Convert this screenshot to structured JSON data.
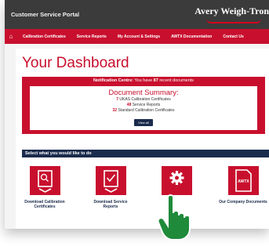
{
  "header": {
    "portal_title": "Customer Service Portal",
    "brand": "Avery Weigh-Tron"
  },
  "nav": {
    "home_icon": "home-icon",
    "items": [
      {
        "label": "Calibration Certificates"
      },
      {
        "label": "Service Reports"
      },
      {
        "label": "My Account & Settings"
      },
      {
        "label": "AWTX Documentation"
      },
      {
        "label": "Contact Us"
      }
    ]
  },
  "dashboard": {
    "title": "Your Dashboard",
    "notification": {
      "prefix": "Notification Centre:",
      "text_before": " You have ",
      "count": "87",
      "text_after": " recent documents"
    },
    "summary": {
      "title": "Document Summary:",
      "lines": [
        {
          "count": "7",
          "label": "UKAS Calibration Certificates"
        },
        {
          "count": "48",
          "label": "Service Reports"
        },
        {
          "count": "32",
          "label": "Standard Calibration Certificates"
        }
      ],
      "view_all": "View all"
    },
    "select_bar": "Select what you would like to do",
    "tiles": [
      {
        "label": "Download Calibration Certificates",
        "icon": "certificate-download-icon"
      },
      {
        "label": "Download Service Reports",
        "icon": "service-report-download-icon"
      },
      {
        "label": "",
        "icon": "gear-icon"
      },
      {
        "label": "Our Company Documents",
        "icon": "awtx-document-icon",
        "icon_text": "AWTX"
      }
    ]
  },
  "colors": {
    "brand_red": "#c8102e",
    "navy": "#1a2b4c",
    "topbar": "#3b3b3b",
    "hand_green": "#1f8a3a"
  }
}
